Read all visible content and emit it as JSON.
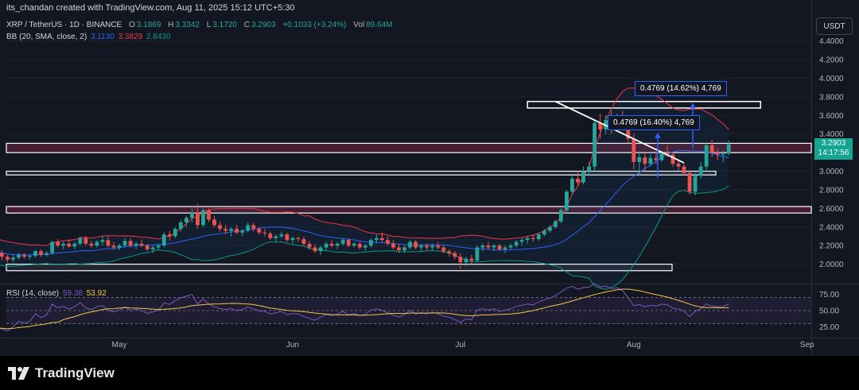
{
  "attribution": "its_chandan created with TradingView.com, Aug 11, 2025 15:12 UTC+5:30",
  "symbol": {
    "title": "XRP / TetherUS · 1D · BINANCE",
    "o_label": "O",
    "o": "3.1869",
    "h_label": "H",
    "h": "3.3342",
    "l_label": "L",
    "l": "3.1720",
    "c_label": "C",
    "c": "3.2903",
    "change": "+0.1033 (+3.24%)",
    "vol_label": "Vol",
    "vol": "89.64M"
  },
  "bb": {
    "label": "BB (20, SMA, close, 2)",
    "basis": "3.1130",
    "upper": "3.3829",
    "lower": "2.8430"
  },
  "rsi": {
    "label": "RSI (14, close)",
    "value": "59.38",
    "ma": "53.92"
  },
  "currency_button": "USDT",
  "last_price": {
    "price": "3.2903",
    "countdown": "14:17:56"
  },
  "measure_labels": [
    {
      "text": "0.4769 (14.62%) 4,769"
    },
    {
      "text": "0.4769 (16.40%) 4,769"
    }
  ],
  "brand": "TradingView",
  "colors": {
    "up": "#26a69a",
    "down": "#ef5350",
    "bb_basis": "#2962ff",
    "bb_upper": "#f23645",
    "bb_lower": "#089981",
    "rsi": "#7e57c2",
    "rsi_ma": "#f7c548",
    "background": "#131722"
  },
  "chart_data": {
    "type": "candlestick",
    "x_axis_labels": [
      "May",
      "Jun",
      "Jul",
      "Aug",
      "Sep"
    ],
    "y_axis": {
      "range": [
        1.8,
        4.5
      ],
      "ticks": [
        "4.4000",
        "4.2000",
        "4.0000",
        "3.8000",
        "3.6000",
        "3.4000",
        "3.2000",
        "3.0000",
        "2.8000",
        "2.6000",
        "2.4000",
        "2.2000",
        "2.0000"
      ]
    },
    "rsi_axis": {
      "range": [
        15,
        85
      ],
      "ticks": [
        "75.00",
        "50.00",
        "25.00"
      ]
    },
    "candles_start": "2025-04-06",
    "candles": [
      [
        2.18,
        2.28,
        2.12,
        2.25
      ],
      [
        2.25,
        2.27,
        2.0,
        2.06
      ],
      [
        2.06,
        2.14,
        2.0,
        2.1
      ],
      [
        2.1,
        2.18,
        2.06,
        2.12
      ],
      [
        2.12,
        2.15,
        2.04,
        2.08
      ],
      [
        2.08,
        2.1,
        2.02,
        2.05
      ],
      [
        2.05,
        2.1,
        2.02,
        2.07
      ],
      [
        2.07,
        2.12,
        2.05,
        2.1
      ],
      [
        2.1,
        2.12,
        2.06,
        2.08
      ],
      [
        2.08,
        2.1,
        2.05,
        2.09
      ],
      [
        2.09,
        2.15,
        2.07,
        2.14
      ],
      [
        2.14,
        2.16,
        2.08,
        2.1
      ],
      [
        2.1,
        2.14,
        2.08,
        2.12
      ],
      [
        2.12,
        2.25,
        2.1,
        2.24
      ],
      [
        2.24,
        2.27,
        2.18,
        2.2
      ],
      [
        2.2,
        2.24,
        2.16,
        2.22
      ],
      [
        2.22,
        2.27,
        2.18,
        2.19
      ],
      [
        2.19,
        2.24,
        2.16,
        2.22
      ],
      [
        2.22,
        2.3,
        2.2,
        2.28
      ],
      [
        2.28,
        2.3,
        2.2,
        2.22
      ],
      [
        2.22,
        2.25,
        2.18,
        2.2
      ],
      [
        2.2,
        2.26,
        2.18,
        2.24
      ],
      [
        2.24,
        2.3,
        2.2,
        2.26
      ],
      [
        2.26,
        2.3,
        2.18,
        2.2
      ],
      [
        2.2,
        2.24,
        2.15,
        2.18
      ],
      [
        2.18,
        2.22,
        2.15,
        2.2
      ],
      [
        2.2,
        2.28,
        2.18,
        2.25
      ],
      [
        2.25,
        2.28,
        2.18,
        2.2
      ],
      [
        2.2,
        2.24,
        2.16,
        2.22
      ],
      [
        2.22,
        2.26,
        2.18,
        2.2
      ],
      [
        2.2,
        2.22,
        2.14,
        2.16
      ],
      [
        2.16,
        2.2,
        2.12,
        2.18
      ],
      [
        2.18,
        2.22,
        2.15,
        2.2
      ],
      [
        2.2,
        2.35,
        2.18,
        2.32
      ],
      [
        2.32,
        2.36,
        2.25,
        2.3
      ],
      [
        2.3,
        2.4,
        2.28,
        2.38
      ],
      [
        2.38,
        2.48,
        2.35,
        2.45
      ],
      [
        2.45,
        2.52,
        2.4,
        2.5
      ],
      [
        2.5,
        2.6,
        2.45,
        2.56
      ],
      [
        2.56,
        2.65,
        2.38,
        2.42
      ],
      [
        2.42,
        2.6,
        2.4,
        2.58
      ],
      [
        2.58,
        2.6,
        2.45,
        2.48
      ],
      [
        2.48,
        2.52,
        2.4,
        2.42
      ],
      [
        2.42,
        2.46,
        2.35,
        2.38
      ],
      [
        2.38,
        2.42,
        2.32,
        2.36
      ],
      [
        2.36,
        2.4,
        2.3,
        2.38
      ],
      [
        2.38,
        2.42,
        2.32,
        2.34
      ],
      [
        2.34,
        2.38,
        2.3,
        2.36
      ],
      [
        2.36,
        2.45,
        2.34,
        2.42
      ],
      [
        2.42,
        2.45,
        2.35,
        2.38
      ],
      [
        2.38,
        2.4,
        2.32,
        2.34
      ],
      [
        2.34,
        2.38,
        2.3,
        2.33
      ],
      [
        2.33,
        2.35,
        2.26,
        2.28
      ],
      [
        2.28,
        2.32,
        2.24,
        2.3
      ],
      [
        2.3,
        2.35,
        2.28,
        2.32
      ],
      [
        2.32,
        2.34,
        2.24,
        2.26
      ],
      [
        2.26,
        2.3,
        2.22,
        2.28
      ],
      [
        2.28,
        2.3,
        2.24,
        2.27
      ],
      [
        2.27,
        2.3,
        2.2,
        2.22
      ],
      [
        2.22,
        2.25,
        2.16,
        2.18
      ],
      [
        2.18,
        2.22,
        2.12,
        2.14
      ],
      [
        2.14,
        2.2,
        2.1,
        2.18
      ],
      [
        2.18,
        2.24,
        2.15,
        2.22
      ],
      [
        2.22,
        2.26,
        2.18,
        2.2
      ],
      [
        2.2,
        2.24,
        2.16,
        2.22
      ],
      [
        2.22,
        2.28,
        2.2,
        2.26
      ],
      [
        2.26,
        2.28,
        2.18,
        2.2
      ],
      [
        2.2,
        2.24,
        2.18,
        2.22
      ],
      [
        2.22,
        2.24,
        2.16,
        2.18
      ],
      [
        2.18,
        2.22,
        2.14,
        2.2
      ],
      [
        2.2,
        2.28,
        2.18,
        2.26
      ],
      [
        2.26,
        2.32,
        2.22,
        2.28
      ],
      [
        2.28,
        2.34,
        2.24,
        2.26
      ],
      [
        2.26,
        2.3,
        2.2,
        2.22
      ],
      [
        2.22,
        2.26,
        2.16,
        2.18
      ],
      [
        2.18,
        2.22,
        2.12,
        2.15
      ],
      [
        2.15,
        2.2,
        2.12,
        2.18
      ],
      [
        2.18,
        2.26,
        2.16,
        2.24
      ],
      [
        2.24,
        2.26,
        2.16,
        2.18
      ],
      [
        2.18,
        2.22,
        2.14,
        2.2
      ],
      [
        2.2,
        2.22,
        2.15,
        2.18
      ],
      [
        2.18,
        2.22,
        2.15,
        2.2
      ],
      [
        2.2,
        2.24,
        2.16,
        2.18
      ],
      [
        2.18,
        2.2,
        2.12,
        2.14
      ],
      [
        2.14,
        2.16,
        2.08,
        2.12
      ],
      [
        2.12,
        2.14,
        2.05,
        2.08
      ],
      [
        2.08,
        2.12,
        1.95,
        2.02
      ],
      [
        2.02,
        2.08,
        1.98,
        2.06
      ],
      [
        2.06,
        2.1,
        2.0,
        2.04
      ],
      [
        2.04,
        2.2,
        2.02,
        2.18
      ],
      [
        2.18,
        2.22,
        2.14,
        2.2
      ],
      [
        2.2,
        2.24,
        2.16,
        2.18
      ],
      [
        2.18,
        2.22,
        2.14,
        2.2
      ],
      [
        2.2,
        2.22,
        2.14,
        2.16
      ],
      [
        2.16,
        2.2,
        2.12,
        2.18
      ],
      [
        2.18,
        2.22,
        2.15,
        2.2
      ],
      [
        2.2,
        2.26,
        2.18,
        2.24
      ],
      [
        2.24,
        2.28,
        2.2,
        2.26
      ],
      [
        2.26,
        2.3,
        2.22,
        2.28
      ],
      [
        2.28,
        2.32,
        2.24,
        2.27
      ],
      [
        2.27,
        2.34,
        2.25,
        2.32
      ],
      [
        2.32,
        2.38,
        2.3,
        2.36
      ],
      [
        2.36,
        2.42,
        2.34,
        2.4
      ],
      [
        2.4,
        2.48,
        2.38,
        2.46
      ],
      [
        2.46,
        2.6,
        2.44,
        2.58
      ],
      [
        2.58,
        2.8,
        2.55,
        2.78
      ],
      [
        2.78,
        2.95,
        2.75,
        2.92
      ],
      [
        2.92,
        3.0,
        2.85,
        2.88
      ],
      [
        2.88,
        3.05,
        2.86,
        3.0
      ],
      [
        3.0,
        3.1,
        2.95,
        3.05
      ],
      [
        3.05,
        3.55,
        3.0,
        3.52
      ],
      [
        3.52,
        3.62,
        3.35,
        3.45
      ],
      [
        3.45,
        3.6,
        3.4,
        3.55
      ],
      [
        3.55,
        3.65,
        3.4,
        3.5
      ],
      [
        3.5,
        3.62,
        3.45,
        3.58
      ],
      [
        3.58,
        3.65,
        3.5,
        3.52
      ],
      [
        3.52,
        3.6,
        3.3,
        3.35
      ],
      [
        3.35,
        3.4,
        3.02,
        3.1
      ],
      [
        3.1,
        3.2,
        2.95,
        3.15
      ],
      [
        3.15,
        3.2,
        3.0,
        3.08
      ],
      [
        3.08,
        3.18,
        3.05,
        3.14
      ],
      [
        3.14,
        3.2,
        3.08,
        3.12
      ],
      [
        3.12,
        3.22,
        3.1,
        3.2
      ],
      [
        3.2,
        3.28,
        3.15,
        3.18
      ],
      [
        3.18,
        3.2,
        3.05,
        3.08
      ],
      [
        3.08,
        3.12,
        3.0,
        3.05
      ],
      [
        3.05,
        3.08,
        2.95,
        2.98
      ],
      [
        2.98,
        3.0,
        2.75,
        2.78
      ],
      [
        2.78,
        2.98,
        2.74,
        2.95
      ],
      [
        2.95,
        3.1,
        2.92,
        3.05
      ],
      [
        3.05,
        3.3,
        3.0,
        3.28
      ],
      [
        3.28,
        3.34,
        3.15,
        3.2
      ],
      [
        3.2,
        3.25,
        3.12,
        3.18
      ],
      [
        3.18,
        3.22,
        3.1,
        3.19
      ],
      [
        3.19,
        3.33,
        3.17,
        3.29
      ]
    ],
    "resistance_zones": [
      [
        3.68,
        3.75
      ]
    ],
    "zones": [
      [
        3.2,
        3.3
      ],
      [
        2.96,
        3.0
      ],
      [
        2.55,
        2.62
      ],
      [
        1.93,
        2.0
      ]
    ],
    "trendline": [
      [
        3.75,
        "2025-07-18"
      ],
      [
        3.09,
        "2025-08-10"
      ]
    ]
  }
}
